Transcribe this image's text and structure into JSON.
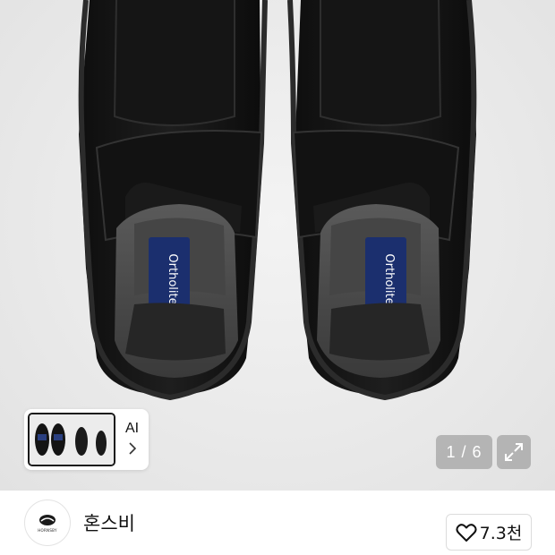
{
  "product_image": {
    "alt": "black velcro-strap loafers, top view",
    "insole_brand": "Ortholite",
    "counter": "1 / 6",
    "expand_icon": "expand-diagonal-arrows-icon"
  },
  "thumbnail_strip": {
    "ai_label": "AI",
    "chevron_icon": "chevron-right-icon"
  },
  "brand": {
    "name": "혼스비",
    "logo_text": "HORNSBY",
    "logo_icon": "brand-logo-icon"
  },
  "like": {
    "icon": "heart-outline-icon",
    "count": "7.3천"
  }
}
